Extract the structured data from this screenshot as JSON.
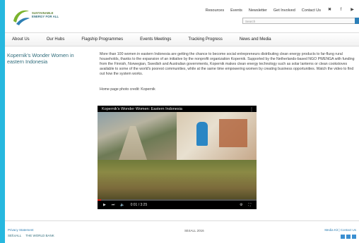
{
  "brand": {
    "logo_line1": "SUSTAINABLE",
    "logo_line2": "ENERGY FOR ALL",
    "accent_green": "#7bb32e",
    "accent_blue": "#2e7fb3"
  },
  "topnav": {
    "items": [
      "Resources",
      "Events",
      "Newsletter",
      "Get Involved",
      "Contact Us"
    ],
    "social": [
      "twitter-icon",
      "facebook-icon",
      "youtube-icon"
    ],
    "social_glyphs": [
      "✖",
      "f",
      "▶"
    ]
  },
  "search": {
    "placeholder": "Search"
  },
  "mainnav": {
    "items": [
      "About Us",
      "Our Hubs",
      "Flagship Programmes",
      "Events Meetings",
      "Tracking Progress",
      "News and Media"
    ]
  },
  "article": {
    "title": "Kopernik's Wonder Women in eastern Indonesia",
    "body": "More than 100 women in eastern Indonesia are getting the chance to become social entrepreneurs distributing clean energy products to far-flung rural households, thanks to the expansion of an initiative by the nonprofit organization Kopernik. Supported by the Netherlands-based NGO PWENGA with funding from the Finnish, Norwegian, Swedish and Australian governments, Kopernik makes clean energy technology such as solar lanterns or clean cookstoves available to some of the world's poorest communities, while at the same time empowering women by creating business opportunities. Watch the video to find out how the system works.",
    "credit": "Home page photo credit: Kopernik"
  },
  "video": {
    "title": "Kopernik's Wonder Women: Eastern Indonesia",
    "time": "0:01 / 3:25",
    "progress_fraction": 0.02
  },
  "footer": {
    "left_link": "Privacy Statement",
    "logo1": "SEforALL",
    "logo2": "THE WORLD BANK",
    "center": "SE4ALL 2016",
    "right_link": "Media Kit | Contact Us"
  }
}
